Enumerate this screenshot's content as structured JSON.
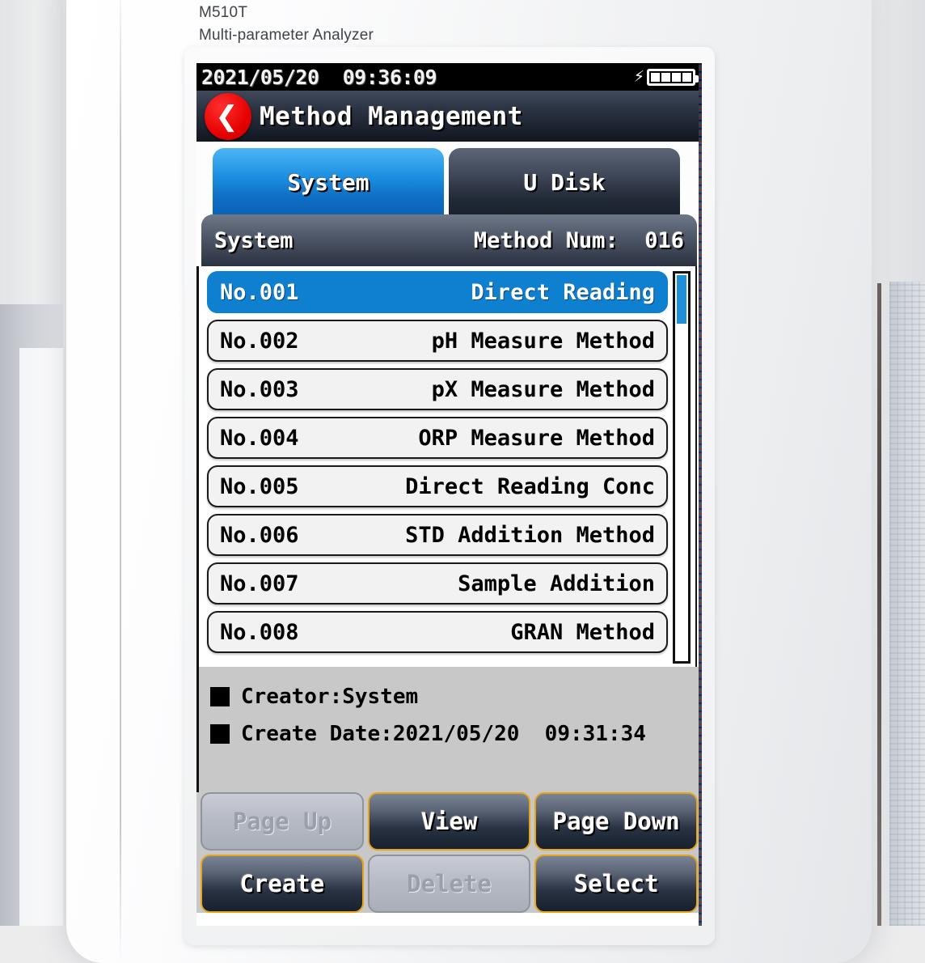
{
  "caption": {
    "model": "M510T",
    "subtitle": "Multi-parameter Analyzer"
  },
  "statusbar": {
    "datetime": "2021/05/20  09:36:09",
    "charging_icon": "lightning-bolt-icon",
    "battery_icon": "battery-full-icon",
    "battery_cells": 4
  },
  "titlebar": {
    "back_icon": "back-arrow-icon",
    "title": "Method Management"
  },
  "tabs": [
    {
      "label": "System",
      "active": true
    },
    {
      "label": "U Disk",
      "active": false
    }
  ],
  "subheader": {
    "source": "System",
    "method_count_label": "Method Num:  016"
  },
  "list": {
    "items": [
      {
        "no": "No.001",
        "name": "Direct Reading",
        "selected": true
      },
      {
        "no": "No.002",
        "name": "pH Measure Method",
        "selected": false
      },
      {
        "no": "No.003",
        "name": "pX Measure Method",
        "selected": false
      },
      {
        "no": "No.004",
        "name": "ORP Measure Method",
        "selected": false
      },
      {
        "no": "No.005",
        "name": "Direct Reading Conc",
        "selected": false
      },
      {
        "no": "No.006",
        "name": "STD Addition Method",
        "selected": false
      },
      {
        "no": "No.007",
        "name": "Sample Addition",
        "selected": false
      },
      {
        "no": "No.008",
        "name": "GRAN Method",
        "selected": false
      }
    ],
    "scrollbar_icon": "vertical-scrollbar"
  },
  "info": {
    "creator": "Creator:System",
    "create_date": "Create Date:2021/05/20  09:31:34"
  },
  "buttons": {
    "row1": [
      {
        "label": "Page Up",
        "state": "disabled"
      },
      {
        "label": "View",
        "state": "active"
      },
      {
        "label": "Page Down",
        "state": "active"
      }
    ],
    "row2": [
      {
        "label": "Create",
        "state": "active"
      },
      {
        "label": "Delete",
        "state": "disabled"
      },
      {
        "label": "Select",
        "state": "active"
      }
    ]
  },
  "colors": {
    "accent_blue": "#0f7fd0",
    "tab_active_blue": "#1c8fe2",
    "back_button_red": "#e60000",
    "button_border_orange": "#e8a317",
    "info_bg_gray": "#c8c8c8"
  }
}
